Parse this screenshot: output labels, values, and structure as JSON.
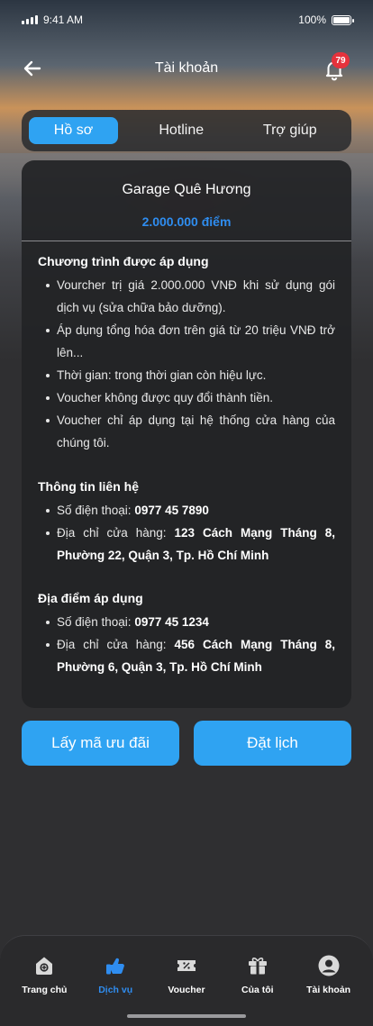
{
  "status_bar": {
    "time": "9:41 AM",
    "battery": "100%"
  },
  "header": {
    "title": "Tài khoản",
    "notification_count": "79"
  },
  "tabs": [
    {
      "label": "Hồ sơ",
      "active": true
    },
    {
      "label": "Hotline",
      "active": false
    },
    {
      "label": "Trợ giúp",
      "active": false
    }
  ],
  "card": {
    "name": "Garage Quê Hương",
    "points": "2.000.000 điểm",
    "program": {
      "title": "Chương trình được áp dụng",
      "items": [
        "Vourcher trị giá 2.000.000 VNĐ khi sử dụng gói dịch vụ (sửa chữa bảo dưỡng).",
        "Áp dụng tổng hóa đơn trên giá từ 20 triệu VNĐ trở lên...",
        "Thời gian: trong thời gian còn hiệu lực.",
        "Voucher không được quy đổi thành tiền.",
        "Voucher chỉ áp dụng tại hệ thống cửa hàng của chúng tôi."
      ]
    },
    "contact": {
      "title": "Thông tin liên hệ",
      "phone_label": "Số điện thoại: ",
      "phone": "0977 45 7890",
      "address_label": "Địa chỉ cửa hàng: ",
      "address": "123 Cách Mạng Tháng 8, Phường 22, Quận 3, Tp. Hồ Chí Minh"
    },
    "location": {
      "title": "Địa điểm áp dụng",
      "phone_label": "Số điện thoại: ",
      "phone": "0977 45 1234",
      "address_label": "Địa chỉ cửa hàng: ",
      "address": "456 Cách Mạng Tháng 8, Phường 6, Quận 3, Tp. Hồ Chí Minh"
    }
  },
  "actions": {
    "get_code": "Lấy mã ưu đãi",
    "book": "Đặt lịch"
  },
  "nav": [
    {
      "label": "Trang chủ",
      "icon": "home-icon",
      "active": false
    },
    {
      "label": "Dịch vụ",
      "icon": "service-icon",
      "active": true
    },
    {
      "label": "Voucher",
      "icon": "voucher-icon",
      "active": false
    },
    {
      "label": "Của tôi",
      "icon": "gift-icon",
      "active": false
    },
    {
      "label": "Tài khoản",
      "icon": "account-icon",
      "active": false
    }
  ],
  "colors": {
    "accent": "#2fa3f2",
    "points": "#2f8df0",
    "badge": "#e5323c",
    "background": "#2f2f31"
  }
}
